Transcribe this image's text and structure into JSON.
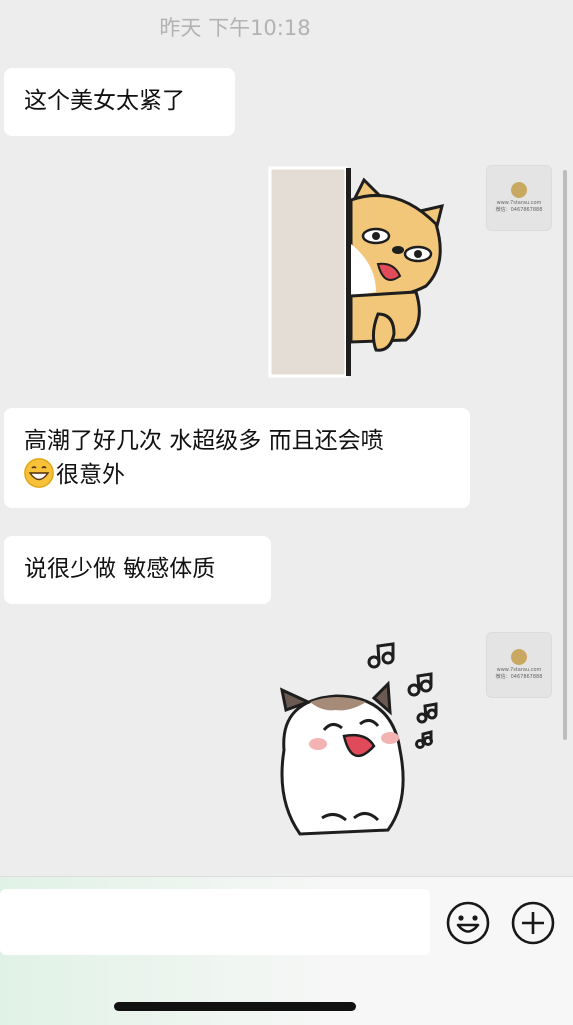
{
  "chat": {
    "timestamp": "昨天 下午10:18",
    "messages": [
      {
        "side": "left",
        "type": "text",
        "text": "这个美女太紧了"
      },
      {
        "side": "right",
        "type": "sticker",
        "sticker": "shiba-peeking-sticker"
      },
      {
        "side": "left",
        "type": "text",
        "text_line1": "高潮了好几次 水超级多 而且还会喷",
        "emoji": "grinning-face-emoji",
        "text_line2": "很意外"
      },
      {
        "side": "left",
        "type": "text",
        "text": "说很少做 敏感体质"
      },
      {
        "side": "right",
        "type": "sticker",
        "sticker": "laughing-cat-sticker"
      }
    ]
  },
  "avatar": {
    "site": "www.7starau.com",
    "phone": "微信：0467867888"
  },
  "input_bar": {
    "input_value": "",
    "emoji_icon": "smiley-icon",
    "add_icon": "plus-circle-icon"
  },
  "colors": {
    "background": "#ededed",
    "bubble": "#ffffff",
    "timestamp": "#b2b2b2"
  }
}
